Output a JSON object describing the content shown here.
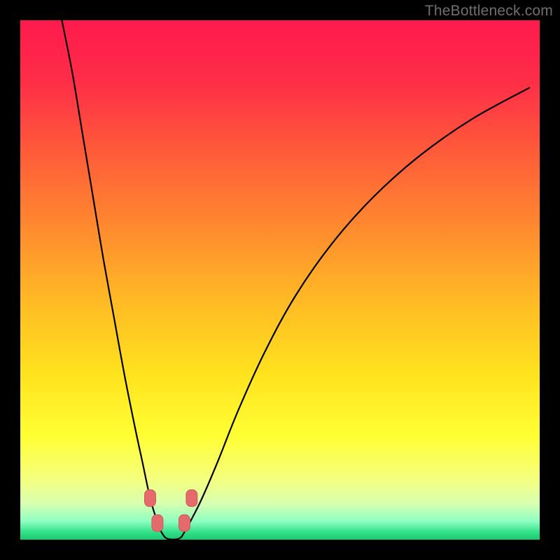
{
  "watermark": "TheBottleneck.com",
  "colors": {
    "frame": "#000000",
    "curve_stroke": "#000000",
    "marker_fill": "#e46a6c",
    "marker_stroke": "#cf5a5c",
    "gradient_stops": [
      {
        "offset": 0.0,
        "color": "#ff1a4d"
      },
      {
        "offset": 0.12,
        "color": "#ff2e47"
      },
      {
        "offset": 0.25,
        "color": "#ff5a3a"
      },
      {
        "offset": 0.4,
        "color": "#ff8a2e"
      },
      {
        "offset": 0.55,
        "color": "#ffbd24"
      },
      {
        "offset": 0.68,
        "color": "#ffe21e"
      },
      {
        "offset": 0.8,
        "color": "#ffff33"
      },
      {
        "offset": 0.88,
        "color": "#f6ff7a"
      },
      {
        "offset": 0.93,
        "color": "#d8ffb0"
      },
      {
        "offset": 0.965,
        "color": "#8dffc0"
      },
      {
        "offset": 0.985,
        "color": "#33e28a"
      },
      {
        "offset": 1.0,
        "color": "#19c96f"
      }
    ]
  },
  "chart_data": {
    "type": "line",
    "title": "",
    "xlabel": "",
    "ylabel": "",
    "xlim": [
      0,
      100
    ],
    "ylim": [
      0,
      100
    ],
    "series": [
      {
        "name": "left-curve",
        "x": [
          8,
          10,
          12,
          14,
          16,
          18,
          20,
          22,
          23.5,
          25,
          26.2,
          27,
          27.8
        ],
        "y": [
          100,
          90,
          78,
          66,
          54,
          43,
          32,
          22,
          15,
          8,
          4,
          1.8,
          0.5
        ]
      },
      {
        "name": "right-curve",
        "x": [
          31.0,
          31.8,
          33,
          35,
          38,
          42,
          47,
          53,
          60,
          68,
          77,
          87,
          98
        ],
        "y": [
          0.5,
          1.8,
          4,
          8,
          15,
          25,
          36,
          47,
          57,
          66,
          74,
          81,
          87
        ]
      }
    ],
    "markers": [
      {
        "name": "left-upper",
        "x": 25.0,
        "y": 8.0
      },
      {
        "name": "left-lower",
        "x": 26.4,
        "y": 3.2
      },
      {
        "name": "right-lower",
        "x": 31.6,
        "y": 3.2
      },
      {
        "name": "right-upper",
        "x": 33.0,
        "y": 8.0
      }
    ]
  }
}
